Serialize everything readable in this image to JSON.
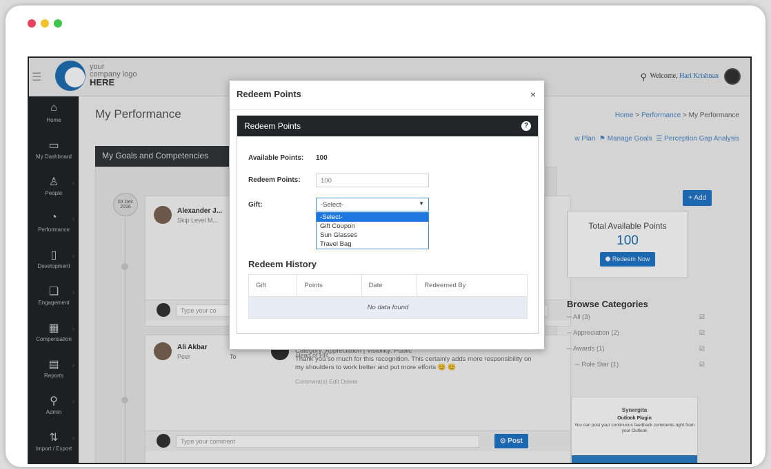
{
  "window_dots": [
    "#e8435a",
    "#f2c12e",
    "#3fc54b"
  ],
  "header": {
    "logo_line1": "your",
    "logo_line2": "company logo",
    "logo_line3": "HERE",
    "welcome_label": "Welcome,",
    "welcome_name": "Hari Krishnan"
  },
  "sidebar": {
    "items": [
      {
        "label": "Home",
        "icon": "home-icon",
        "glyph": "⌂"
      },
      {
        "label": "My Dashboard",
        "icon": "monitor-icon",
        "glyph": "▭"
      },
      {
        "label": "People",
        "icon": "people-icon",
        "glyph": "♙"
      },
      {
        "label": "Performance",
        "icon": "gauge-icon",
        "glyph": "◔"
      },
      {
        "label": "Development",
        "icon": "tablet-icon",
        "glyph": "▯"
      },
      {
        "label": "Engagement",
        "icon": "chat-icon",
        "glyph": "❏"
      },
      {
        "label": "Compensation",
        "icon": "money-icon",
        "glyph": "▦"
      },
      {
        "label": "Reports",
        "icon": "report-icon",
        "glyph": "▤"
      },
      {
        "label": "Admin",
        "icon": "wrench-icon",
        "glyph": "⚲"
      },
      {
        "label": "Import / Export",
        "icon": "import-export-icon",
        "glyph": "⇅"
      }
    ]
  },
  "main": {
    "page_title": "My Performance",
    "breadcrumb": {
      "home": "Home",
      "sep1": ">",
      "performance": "Performance",
      "sep2": ">",
      "current": "My Performance"
    },
    "links": {
      "plan": "w Plan",
      "manage_goals": "Manage Goals",
      "perception": "Perception Gap Analysis"
    },
    "tab": "My Goals and Competencies",
    "date_badge_line1": "03 Dec",
    "date_badge_line2": "2016",
    "card1": {
      "name": "Alexander J...",
      "role": "Skip Level M...",
      "comment_placeholder": "Type your co"
    },
    "card2": {
      "name": "Ali Akbar",
      "role": "Peer",
      "to": "To",
      "recipient_role": "Head of HR",
      "category_line": "Category: Appreciation | Visibility: Public",
      "message": "Thank you so much for this recognition. This certainly adds more responsibility on my shoulders to work better and put more efforts 😊 😊",
      "actions": "Comment(s)   Edit   Delete",
      "comment_placeholder": "Type your comment",
      "post_label": "Post"
    }
  },
  "right": {
    "add_label": "+ Add",
    "points_title": "Total Available Points",
    "points_value": "100",
    "redeem_now": "Redeem Now",
    "browse_title": "Browse Categories",
    "categories": [
      {
        "label": "All (3)"
      },
      {
        "label": "Appreciation (2)"
      },
      {
        "label": "Awards (1)"
      },
      {
        "label": "Role Star (1)"
      }
    ],
    "plugin": {
      "brand": "Synergita",
      "title": "Outlook Plugin",
      "desc": "You can post your continuous feedback comments right from your Outlook"
    }
  },
  "modal": {
    "title": "Redeem Points",
    "close": "×",
    "panel_title": "Redeem Points",
    "available_label": "Available Points:",
    "available_value": "100",
    "redeem_label": "Redeem Points:",
    "redeem_value": "100",
    "gift_label": "Gift:",
    "gift_selected": "-Select-",
    "gift_options": [
      "-Select-",
      "Gift Coupon",
      "Sun Glasses",
      "Travel Bag"
    ],
    "history_title": "Redeem History",
    "history_columns": [
      "Gift",
      "Points",
      "Date",
      "Redeemed By"
    ],
    "history_empty": "No data found"
  }
}
